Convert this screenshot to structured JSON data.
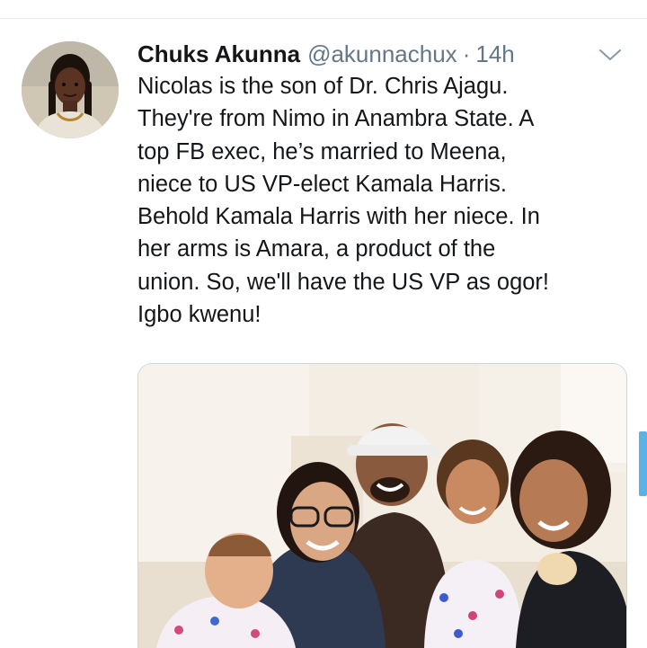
{
  "tweet": {
    "display_name": "Chuks Akunna",
    "handle": "@akunnachux",
    "separator": "·",
    "time": "14h",
    "text_lines": [
      "Nicolas is the son of Dr. Chris Ajagu.",
      "They're from Nimo in Anambra State. A",
      "top FB exec, he’s married to Meena,",
      "niece to US VP-elect Kamala Harris.",
      "Behold Kamala Harris with her niece. In",
      "her arms is Amara, a product of the",
      "union. So, we'll have the US VP as ogor!",
      "Igbo kwenu!"
    ],
    "avatar_icon": "user-avatar",
    "menu_icon": "chevron-down-icon"
  },
  "colors": {
    "text": "#14171a",
    "secondary": "#657786",
    "border": "#ccd6dd",
    "accent": "#5ab2e6"
  }
}
